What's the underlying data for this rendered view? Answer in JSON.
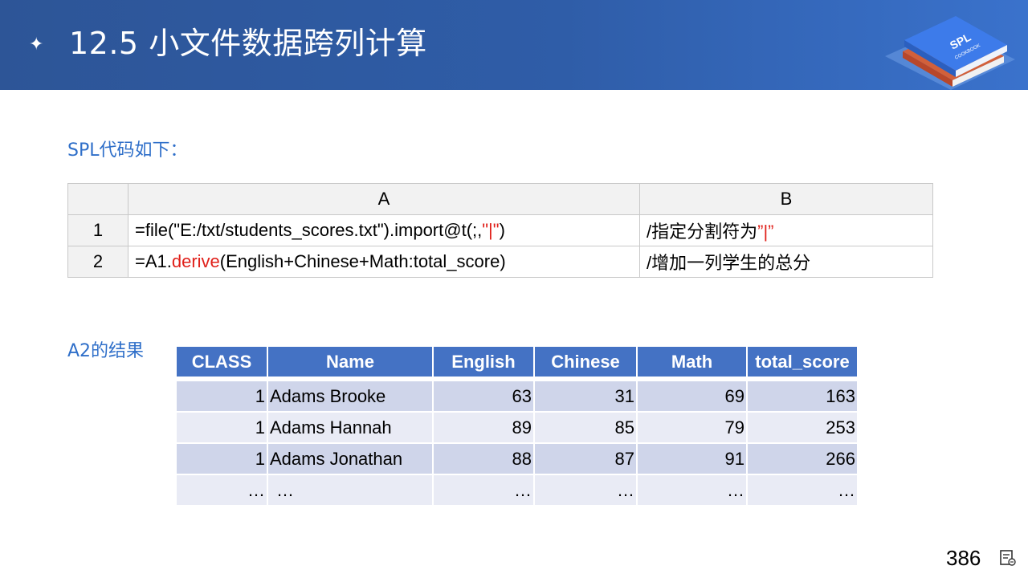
{
  "header": {
    "title": "12.5 小文件数据跨列计算",
    "logo_text": "SPL",
    "logo_subtext": "COOKBOOK"
  },
  "code_section": {
    "label": "SPL代码如下：",
    "col_headers": [
      "A",
      "B"
    ],
    "rows": [
      {
        "num": "1",
        "a_pre": "=file(\"E:/txt/students_scores.txt\").import@t(;,",
        "a_red": "\"|\"",
        "a_post": ")",
        "b_pre": "/指定分割符为",
        "b_red": "”|”"
      },
      {
        "num": "2",
        "a_pre": "=A1.",
        "a_red": "derive",
        "a_post": "(English+Chinese+Math:total_score)",
        "b_pre": "/增加一列学生的总分",
        "b_red": ""
      }
    ]
  },
  "result_section": {
    "label": "A2的结果",
    "columns": [
      "CLASS",
      "Name",
      "English",
      "Chinese",
      "Math",
      "total_score"
    ],
    "rows": [
      [
        "1",
        "Adams Brooke",
        "63",
        "31",
        "69",
        "163"
      ],
      [
        "1",
        "Adams Hannah",
        "89",
        "85",
        "79",
        "253"
      ],
      [
        "1",
        "Adams Jonathan",
        "88",
        "87",
        "91",
        "266"
      ],
      [
        "…",
        "…",
        "…",
        "…",
        "…",
        "…"
      ]
    ]
  },
  "footer": {
    "page_number": "386"
  },
  "colors": {
    "header_bg": "#2f5da8",
    "accent_blue": "#2f6fc9",
    "table_header_bg": "#4472c4",
    "row_odd": "#cfd5ea",
    "row_even": "#e9ebf5",
    "highlight_red": "#e0201a"
  }
}
